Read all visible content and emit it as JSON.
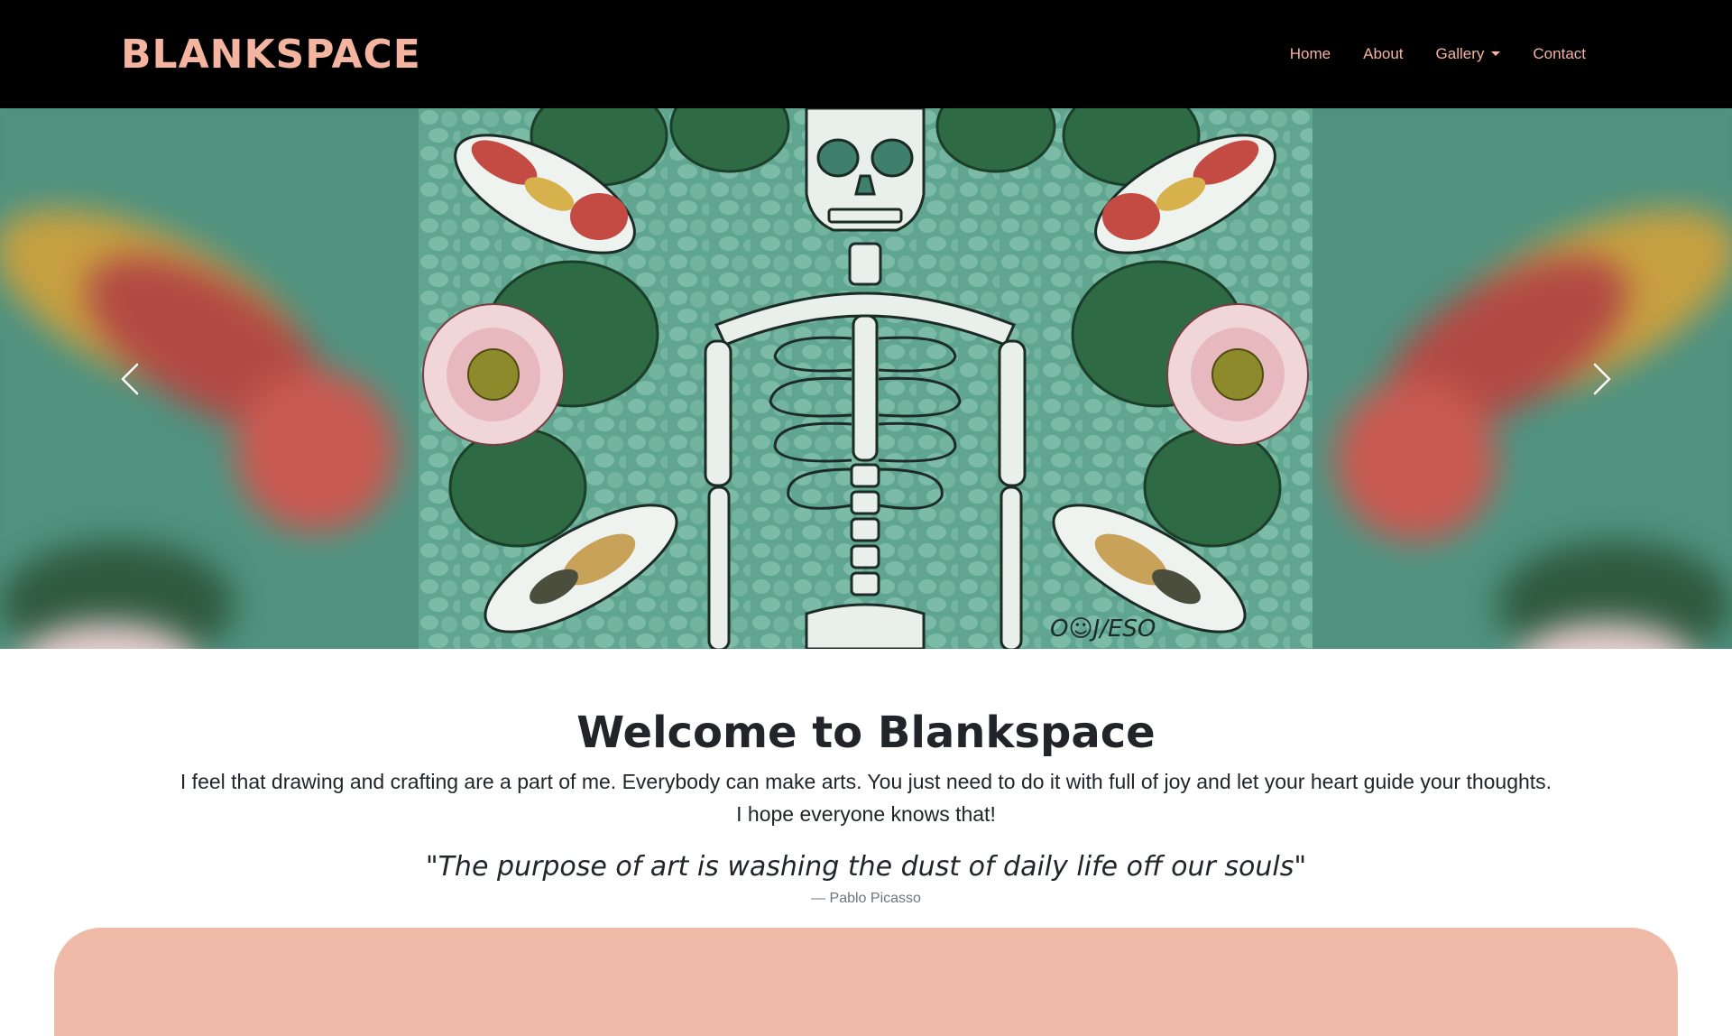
{
  "nav": {
    "brand": "BLANKSPACE",
    "links": [
      "Home",
      "About",
      "Gallery",
      "Contact"
    ]
  },
  "carousel": {
    "prev_label": "Previous",
    "next_label": "Next",
    "signature": "O☺J/ESO"
  },
  "welcome": {
    "title": "Welcome to Blankspace",
    "text_line1": "I feel that drawing and crafting are a part of me. Everybody can make arts. You just need to do it with full of joy and let your heart guide your thoughts.",
    "text_line2": "I hope everyone knows that!",
    "quote": "\"The purpose of art is washing the dust of daily life off our souls\"",
    "quote_author": "— Pablo Picasso"
  },
  "colors": {
    "accent": "#f4b4a0",
    "navbar_bg": "#000000",
    "panel_bg": "#efbaa8",
    "art_bg": "#5fa58f"
  }
}
